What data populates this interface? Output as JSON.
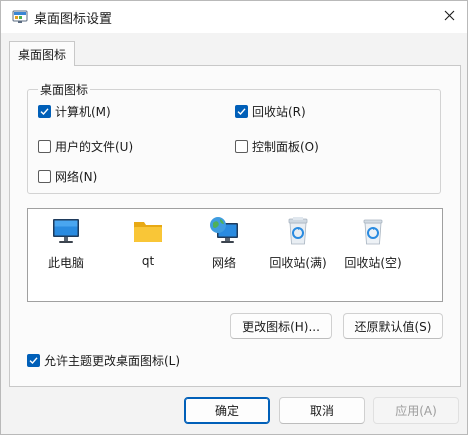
{
  "window": {
    "title": "桌面图标设置"
  },
  "tabs": [
    {
      "label": "桌面图标"
    }
  ],
  "group": {
    "title": "桌面图标",
    "checkboxes": [
      {
        "label": "计算机(M)",
        "checked": true
      },
      {
        "label": "回收站(R)",
        "checked": true
      },
      {
        "label": "用户的文件(U)",
        "checked": false
      },
      {
        "label": "控制面板(O)",
        "checked": false
      },
      {
        "label": "网络(N)",
        "checked": false
      }
    ]
  },
  "icons": [
    {
      "label": "此电脑",
      "icon": "monitor-icon"
    },
    {
      "label": "qt",
      "icon": "folder-icon"
    },
    {
      "label": "网络",
      "icon": "network-globe-icon"
    },
    {
      "label": "回收站(满)",
      "icon": "recycle-bin-full-icon"
    },
    {
      "label": "回收站(空)",
      "icon": "recycle-bin-empty-icon"
    }
  ],
  "buttons": {
    "change_icon": "更改图标(H)...",
    "restore_default": "还原默认值(S)",
    "ok": "确定",
    "cancel": "取消",
    "apply": "应用(A)"
  },
  "allow_themes": {
    "label": "允许主题更改桌面图标(L)",
    "checked": true
  },
  "colors": {
    "accent": "#005fb8"
  }
}
